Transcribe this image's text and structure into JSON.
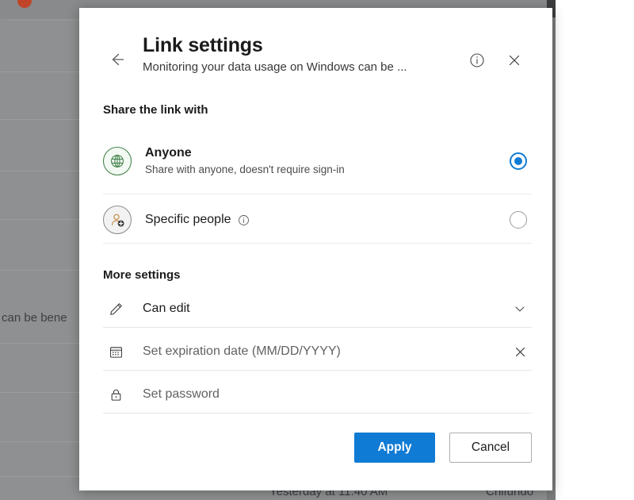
{
  "background": {
    "text_left": "can be bene",
    "text_bottom_date": "Yesterday at 11:40 AM",
    "text_bottom_user": "Chifundo",
    "overlay_color": "#8f9091"
  },
  "dialog": {
    "back_label": "back-arrow",
    "title": "Link settings",
    "subtitle": "Monitoring your data usage on Windows can be ...",
    "info_label": "info",
    "close_label": "close",
    "share_section": {
      "heading": "Share the link with",
      "options": [
        {
          "id": "anyone",
          "title": "Anyone",
          "subtitle": "Share with anyone, doesn't require sign-in",
          "icon": "globe-icon",
          "selected": true,
          "has_info": false
        },
        {
          "id": "specific-people",
          "title": "Specific people",
          "subtitle": "",
          "icon": "person-add-icon",
          "selected": false,
          "has_info": true
        }
      ]
    },
    "more_section": {
      "heading": "More settings",
      "fields": [
        {
          "id": "permission",
          "icon": "pencil-icon",
          "value": "Can edit",
          "trailing": "chevron-down-icon",
          "is_placeholder": false
        },
        {
          "id": "expiration",
          "icon": "calendar-icon",
          "value": "Set expiration date (MM/DD/YYYY)",
          "trailing": "clear-x-icon",
          "is_placeholder": true
        },
        {
          "id": "password",
          "icon": "lock-icon",
          "value": "Set password",
          "trailing": "",
          "is_placeholder": true
        }
      ]
    },
    "footer": {
      "apply_label": "Apply",
      "cancel_label": "Cancel",
      "apply_color": "#0f7bd4"
    }
  }
}
